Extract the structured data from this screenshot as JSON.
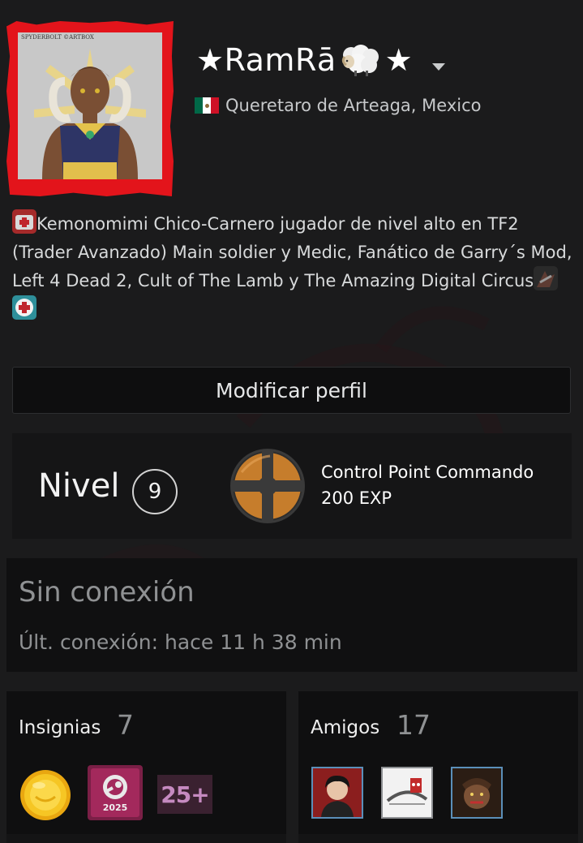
{
  "profile": {
    "name_prefix": "★RamRā",
    "name_suffix": "★",
    "location": "Queretaro de Arteaga, Mexico",
    "flag_colors": [
      "#006847",
      "#ffffff",
      "#ce1126"
    ],
    "avatar_frame_color": "#e3141b",
    "avatar_caption": "SPYDERBOLT ©ARTBOX",
    "summary": "Kemonomimi Chico-Carnero jugador de nivel alto en TF2 (Trader Avanzado) Main soldier y Medic, Fanático de Garry´s Mod, Left 4 Dead 2, Cult of The Lamb y The Amazing Digital Circus"
  },
  "actions": {
    "edit_profile_label": "Modificar perfil"
  },
  "level": {
    "label": "Nivel",
    "value": "9",
    "featured_badge": {
      "name": "Control Point Commando",
      "xp": "200 EXP",
      "icon": "tf2-logo-icon",
      "accent": "#c67d2c"
    }
  },
  "status": {
    "state": "Sin conexión",
    "last_online": "Últ. conexión: hace 11 h 38 min"
  },
  "badges_section": {
    "title": "Insignias",
    "count": "7",
    "items": [
      {
        "icon": "gold-coin-badge-icon"
      },
      {
        "icon": "steam-replay-badge-icon",
        "text": "2025"
      },
      {
        "icon": "years-of-service-badge-icon",
        "text": "25+"
      }
    ]
  },
  "friends_section": {
    "title": "Amigos",
    "count": "17",
    "items": [
      {
        "icon": "friend-avatar-icon"
      },
      {
        "icon": "friend-avatar-icon"
      },
      {
        "icon": "friend-avatar-icon"
      }
    ]
  }
}
